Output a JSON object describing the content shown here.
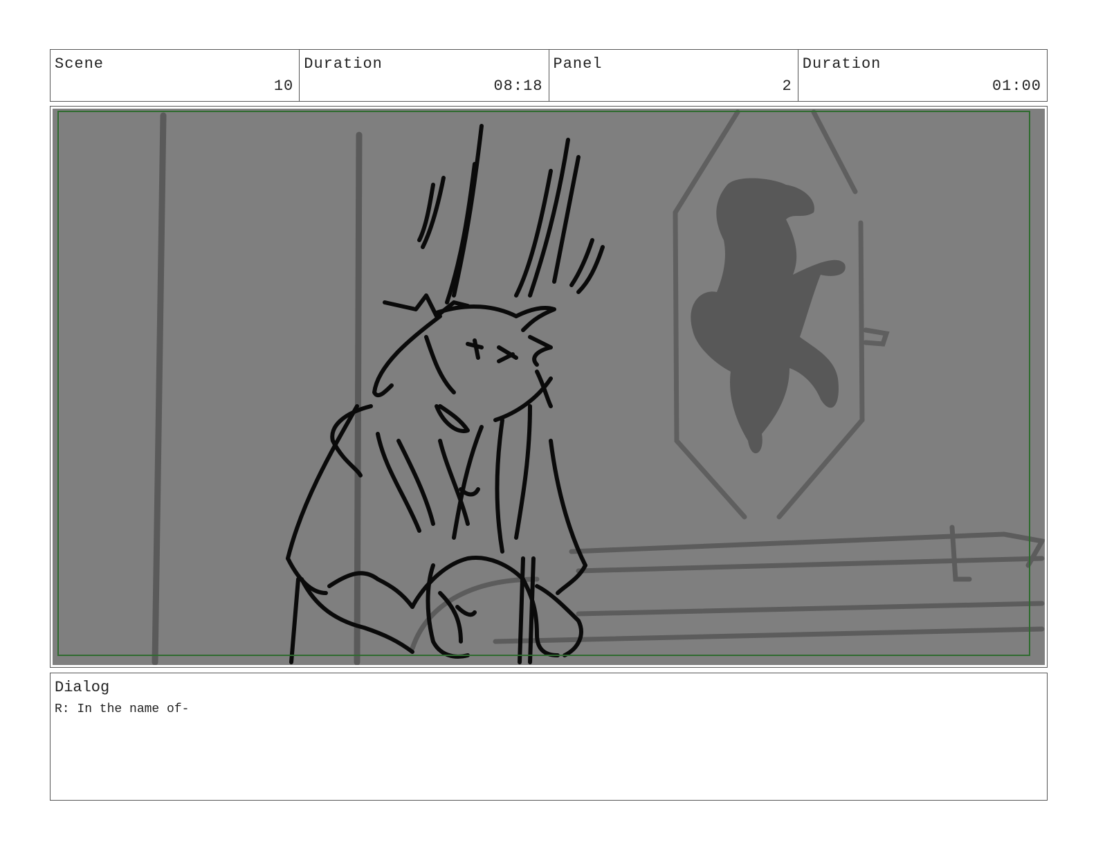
{
  "header": {
    "scene_label": "Scene",
    "scene_value": "10",
    "scene_duration_label": "Duration",
    "scene_duration_value": "08:18",
    "panel_label": "Panel",
    "panel_value": "2",
    "panel_duration_label": "Duration",
    "panel_duration_value": "01:00"
  },
  "dialog": {
    "label": "Dialog",
    "text": "R: In the name of-"
  },
  "colors": {
    "panel_background": "#7f7f7f",
    "safe_area_border": "#2f6b2f",
    "sketch_dark": "#0a0a0a",
    "sketch_grey": "#555555"
  }
}
